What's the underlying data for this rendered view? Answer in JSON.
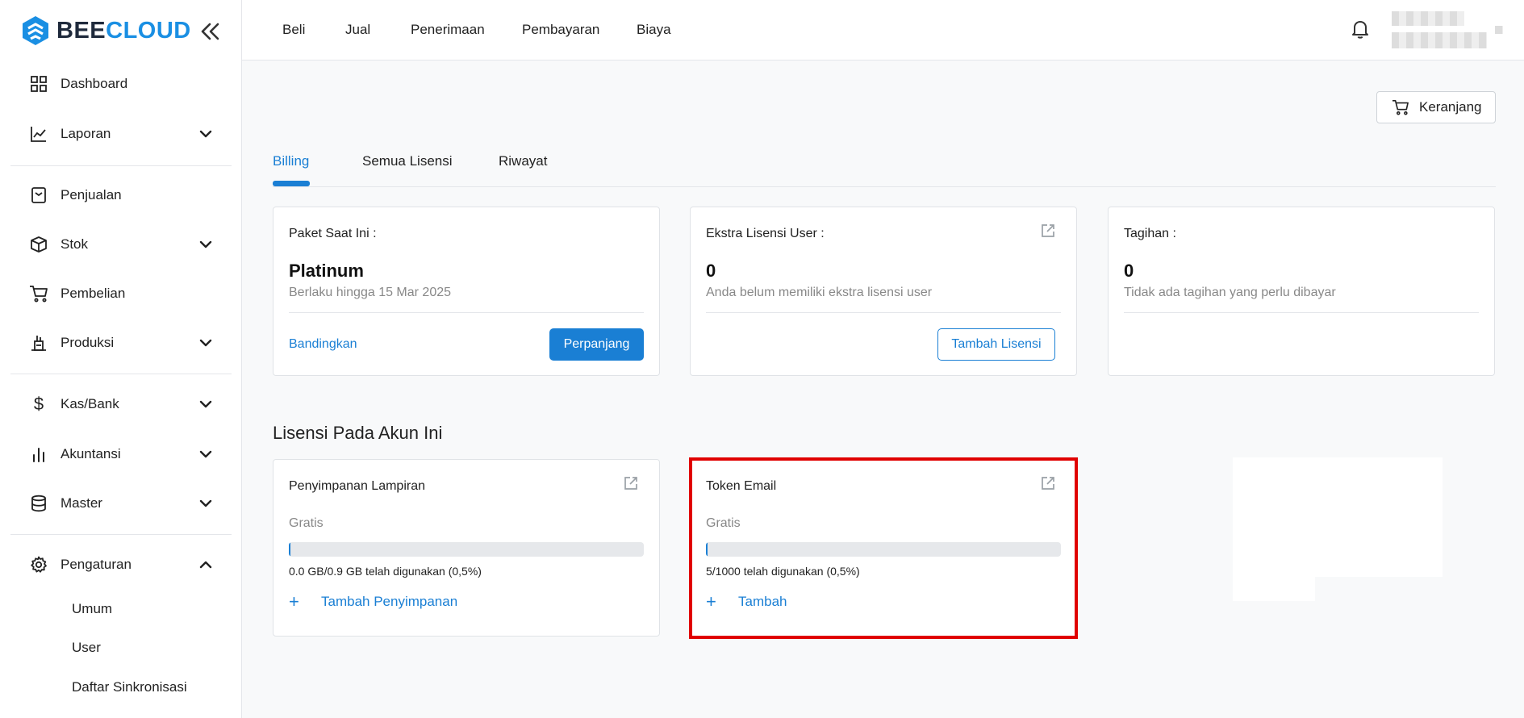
{
  "brand": {
    "name_part1": "BEE",
    "name_part2": "CLOUD",
    "primary_color": "#1a7fd4",
    "logo_color": "#1a8fe3"
  },
  "sidebar": {
    "items": [
      {
        "label": "Dashboard",
        "icon": "grid-icon"
      },
      {
        "label": "Laporan",
        "icon": "line-chart-icon"
      },
      {
        "label": "Penjualan",
        "icon": "receipt-icon"
      },
      {
        "label": "Stok",
        "icon": "box-icon"
      },
      {
        "label": "Pembelian",
        "icon": "cart-icon"
      },
      {
        "label": "Produksi",
        "icon": "factory-icon"
      },
      {
        "label": "Kas/Bank",
        "icon": "dollar-icon"
      },
      {
        "label": "Akuntansi",
        "icon": "bar-chart-icon"
      },
      {
        "label": "Master",
        "icon": "database-icon"
      },
      {
        "label": "Pengaturan",
        "icon": "gear-icon"
      }
    ],
    "subitems": [
      "Umum",
      "User",
      "Daftar Sinkronisasi"
    ]
  },
  "topbar": {
    "menu": [
      "Beli",
      "Jual",
      "Penerimaan",
      "Pembayaran",
      "Biaya"
    ]
  },
  "cart_button": "Keranjang",
  "tabs": [
    "Billing",
    "Semua Lisensi",
    "Riwayat"
  ],
  "billing": {
    "paket": {
      "title": "Paket Saat Ini :",
      "value": "Platinum",
      "sub": "Berlaku hingga 15 Mar 2025",
      "compare": "Bandingkan",
      "renew": "Perpanjang"
    },
    "extra": {
      "title": "Ekstra Lisensi User :",
      "value": "0",
      "sub": "Anda belum memiliki ekstra lisensi user",
      "add": "Tambah Lisensi"
    },
    "tagihan": {
      "title": "Tagihan :",
      "value": "0",
      "sub": "Tidak ada tagihan yang perlu dibayar"
    }
  },
  "licenses": {
    "title": "Lisensi Pada Akun Ini",
    "storage": {
      "title": "Penyimpanan Lampiran",
      "plan": "Gratis",
      "usage": "0.0 GB/0.9 GB telah digunakan (0,5%)",
      "used_fraction": 0.005,
      "add": "Tambah Penyimpanan"
    },
    "email": {
      "title": "Token Email",
      "plan": "Gratis",
      "usage": "5/1000 telah digunakan (0,5%)",
      "used_fraction": 0.005,
      "add": "Tambah"
    }
  }
}
